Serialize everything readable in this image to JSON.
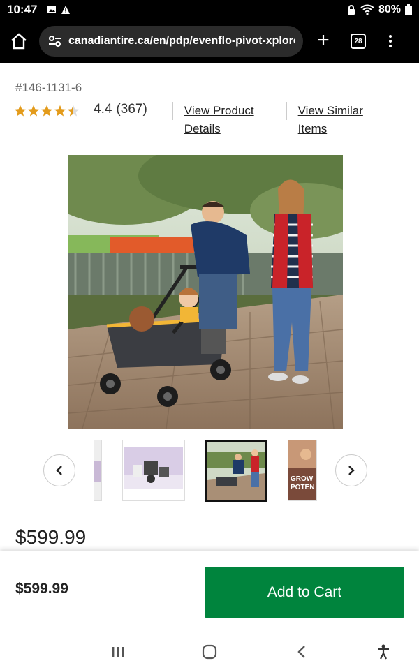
{
  "status": {
    "time": "10:47",
    "battery": "80%"
  },
  "browser": {
    "url": "canadiantire.ca/en/pdp/evenflo-pivot-xplore-",
    "tab_count": "28"
  },
  "product": {
    "sku": "#146-1131-6",
    "rating_value": 4.4,
    "rating_text": "4.4",
    "review_count": "(367)",
    "view_details_line1": "View Product",
    "view_details_line2": "Details",
    "view_similar_line1": "View Similar",
    "view_similar_line2": "Items",
    "price": "$599.99"
  },
  "carousel": {
    "prev_icon": "chevron-left-icon",
    "next_icon": "chevron-right-icon"
  },
  "thumb_text": {
    "line1": "GROW",
    "line2": "POTEN"
  },
  "bottom_bar": {
    "price": "$599.99",
    "add_to_cart": "Add to Cart"
  },
  "colors": {
    "accent": "#00843d",
    "star": "#e39b1b"
  }
}
